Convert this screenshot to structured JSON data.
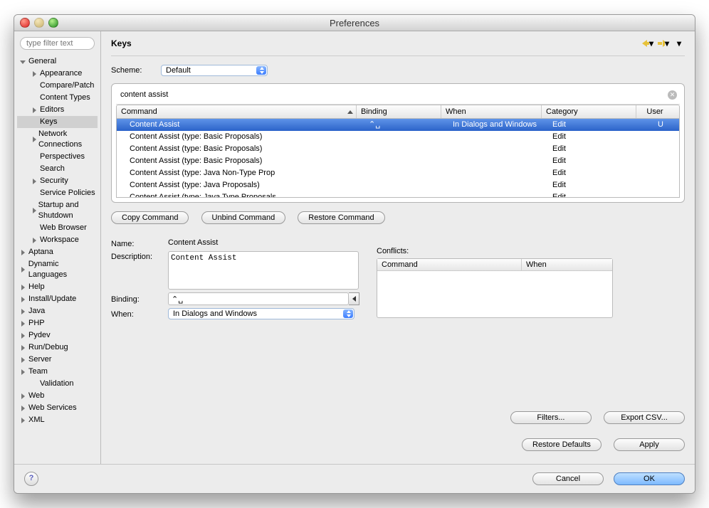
{
  "window": {
    "title": "Preferences"
  },
  "sidebar": {
    "filter_placeholder": "type filter text",
    "nodes": [
      {
        "label": "General",
        "depth": 0,
        "expand": "open"
      },
      {
        "label": "Appearance",
        "depth": 1,
        "expand": "closed"
      },
      {
        "label": "Compare/Patch",
        "depth": 1,
        "expand": "none"
      },
      {
        "label": "Content Types",
        "depth": 1,
        "expand": "none"
      },
      {
        "label": "Editors",
        "depth": 1,
        "expand": "closed"
      },
      {
        "label": "Keys",
        "depth": 1,
        "expand": "none",
        "selected": true
      },
      {
        "label": "Network Connections",
        "depth": 1,
        "expand": "closed"
      },
      {
        "label": "Perspectives",
        "depth": 1,
        "expand": "none"
      },
      {
        "label": "Search",
        "depth": 1,
        "expand": "none"
      },
      {
        "label": "Security",
        "depth": 1,
        "expand": "closed"
      },
      {
        "label": "Service Policies",
        "depth": 1,
        "expand": "none"
      },
      {
        "label": "Startup and Shutdown",
        "depth": 1,
        "expand": "closed"
      },
      {
        "label": "Web Browser",
        "depth": 1,
        "expand": "none"
      },
      {
        "label": "Workspace",
        "depth": 1,
        "expand": "closed"
      },
      {
        "label": "Aptana",
        "depth": 0,
        "expand": "closed"
      },
      {
        "label": "Dynamic Languages",
        "depth": 0,
        "expand": "closed"
      },
      {
        "label": "Help",
        "depth": 0,
        "expand": "closed"
      },
      {
        "label": "Install/Update",
        "depth": 0,
        "expand": "closed"
      },
      {
        "label": "Java",
        "depth": 0,
        "expand": "closed"
      },
      {
        "label": "PHP",
        "depth": 0,
        "expand": "closed"
      },
      {
        "label": "Pydev",
        "depth": 0,
        "expand": "closed"
      },
      {
        "label": "Run/Debug",
        "depth": 0,
        "expand": "closed"
      },
      {
        "label": "Server",
        "depth": 0,
        "expand": "closed"
      },
      {
        "label": "Team",
        "depth": 0,
        "expand": "closed"
      },
      {
        "label": "Validation",
        "depth": 1,
        "expand": "none"
      },
      {
        "label": "Web",
        "depth": 0,
        "expand": "closed"
      },
      {
        "label": "Web Services",
        "depth": 0,
        "expand": "closed"
      },
      {
        "label": "XML",
        "depth": 0,
        "expand": "closed"
      }
    ]
  },
  "page": {
    "title": "Keys",
    "scheme_label": "Scheme:",
    "scheme_value": "Default",
    "search_value": "content assist",
    "columns": {
      "command": "Command",
      "binding": "Binding",
      "when": "When",
      "category": "Category",
      "user": "User"
    },
    "rows": [
      {
        "command": "Content Assist",
        "binding": "⌃␣",
        "when": "In Dialogs and Windows",
        "category": "Edit",
        "user": "U",
        "selected": true
      },
      {
        "command": "Content Assist (type: Basic Proposals)",
        "binding": "",
        "when": "",
        "category": "Edit",
        "user": ""
      },
      {
        "command": "Content Assist (type: Basic Proposals)",
        "binding": "",
        "when": "",
        "category": "Edit",
        "user": ""
      },
      {
        "command": "Content Assist (type: Basic Proposals)",
        "binding": "",
        "when": "",
        "category": "Edit",
        "user": ""
      },
      {
        "command": "Content Assist (type: Java Non-Type Prop",
        "binding": "",
        "when": "",
        "category": "Edit",
        "user": ""
      },
      {
        "command": "Content Assist (type: Java Proposals)",
        "binding": "",
        "when": "",
        "category": "Edit",
        "user": ""
      },
      {
        "command": "Content Assist (type: Java Type Proposals",
        "binding": "",
        "when": "",
        "category": "Edit",
        "user": ""
      }
    ],
    "buttons": {
      "copy": "Copy Command",
      "unbind": "Unbind Command",
      "restore_cmd": "Restore Command",
      "filters": "Filters...",
      "export": "Export CSV...",
      "restore_defaults": "Restore Defaults",
      "apply": "Apply"
    },
    "form": {
      "name_label": "Name:",
      "name_value": "Content Assist",
      "desc_label": "Description:",
      "desc_value": "Content Assist",
      "binding_label": "Binding:",
      "binding_value": "⌃␣",
      "when_label": "When:",
      "when_value": "In Dialogs and Windows",
      "conflicts_label": "Conflicts:",
      "confl_command": "Command",
      "confl_when": "When"
    }
  },
  "footer": {
    "cancel": "Cancel",
    "ok": "OK"
  }
}
